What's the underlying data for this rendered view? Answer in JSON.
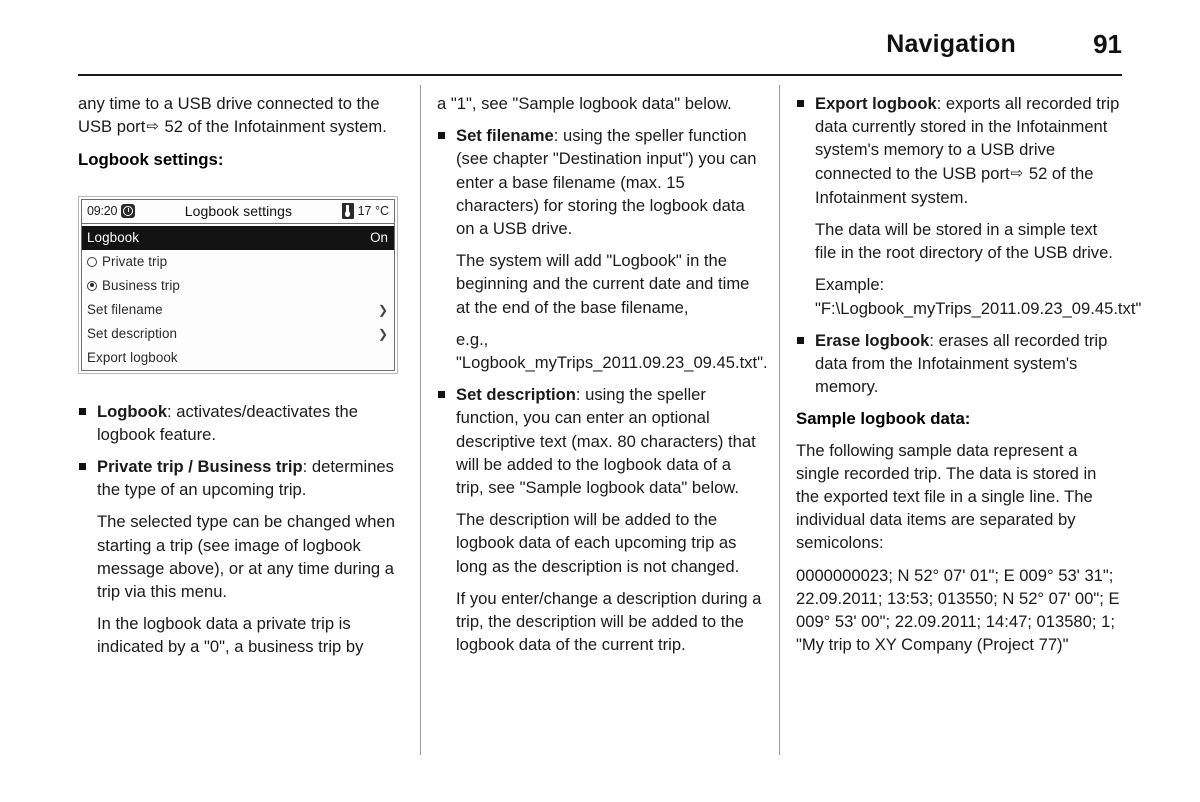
{
  "header": {
    "title": "Navigation",
    "page_number": "91"
  },
  "column1": {
    "intro_para": {
      "before": "any time to a USB drive connected to the USB port",
      "arrow_icon": "⇨",
      "after": "52 of the Infotainment system."
    },
    "subhead": "Logbook settings:",
    "screen": {
      "time": "09:20",
      "clock_icon": "clock-icon",
      "title": "Logbook settings",
      "thermometer_icon": "thermometer-icon",
      "temperature": "17 °C",
      "rows": [
        {
          "label": "Logbook",
          "value": "On",
          "type": "selected"
        },
        {
          "label": "Private trip",
          "type": "radio",
          "selected": false
        },
        {
          "label": "Business trip",
          "type": "radio",
          "selected": true
        },
        {
          "label": "Set filename",
          "type": "submenu",
          "arrow": "❯"
        },
        {
          "label": "Set description",
          "type": "submenu",
          "arrow": "❯"
        },
        {
          "label": "Export logbook",
          "type": "plain"
        }
      ]
    },
    "bullets": [
      {
        "lead": "Logbook",
        "text": ": activates/deactivates the logbook feature."
      },
      {
        "lead": "Private trip / Business trip",
        "text": ": determines the type of an upcoming trip."
      }
    ],
    "paras": [
      "The selected type can be changed when starting a trip (see image of logbook message above), or at any time during a trip via this menu.",
      "In the logbook data a private trip is indicated by a \"0\", a business trip by"
    ]
  },
  "column2": {
    "continuation": "a \"1\", see \"Sample logbook data\" below.",
    "bullet_filename": {
      "lead": "Set filename",
      "text": ": using the speller function (see chapter \"Destination input\") you can enter a base filename (max. 15 characters) for storing the logbook data on a USB drive."
    },
    "para_filename_detail": "The system will add \"Logbook\" in the beginning and the current date and time at the end of the base filename,",
    "para_filename_example": "e.g., \"Logbook_myTrips_2011.09.23_09.45.txt\".",
    "bullet_description": {
      "lead": "Set description",
      "text": ": using the speller function, you can enter an optional descriptive text (max. 80 characters) that will be added to the logbook data of a trip, see \"Sample logbook data\" below."
    },
    "para_description_1": "The description will be added to the logbook data of each upcoming trip as long as the description is not changed.",
    "para_description_2": "If you enter/change a description during a trip, the description will be added to the logbook data of the current trip."
  },
  "column3": {
    "bullet_export": {
      "lead": "Export logbook",
      "before": ": exports all recorded trip data currently stored in the Infotainment system's memory to a USB drive connected to the USB port",
      "arrow_icon": "⇨",
      "after": "52 of the Infotainment system."
    },
    "para_storage": "The data will be stored in a simple text file in the root directory of the USB drive.",
    "para_example": "Example: \"F:\\Logbook_myTrips_2011.09.23_09.45.txt\"",
    "bullet_erase": {
      "lead": "Erase logbook",
      "text": ": erases all recorded trip data from the Infotainment system's memory."
    },
    "subhead": "Sample logbook data:",
    "para_sample_intro": "The following sample data represent a single recorded trip. The data is stored in the exported text file in a single line. The individual data items are separated by semicolons:",
    "sample_data": "0000000023; N 52° 07' 01\"; E 009° 53' 31\"; 22.09.2011; 13:53; 013550; N 52° 07' 00\"; E 009° 53' 00\"; 22.09.2011; 14:47; 013580; 1; \"My trip to XY Company (Project 77)\""
  }
}
